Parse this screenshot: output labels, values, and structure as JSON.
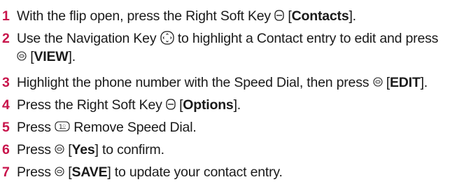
{
  "steps": [
    {
      "num": "1",
      "a": "With the flip open, press the Right Soft Key ",
      "b1": " [",
      "bold": "Contacts",
      "c": "]."
    },
    {
      "num": "2",
      "a": "Use the Navigation Key ",
      "b": " to highlight a Contact entry to edit and press",
      "line2_b": " [",
      "bold": "VIEW",
      "c": "]."
    },
    {
      "num": "3",
      "a": "Highlight the phone number with the Speed Dial, then press ",
      "b1": " [",
      "bold": "EDIT",
      "c": "]."
    },
    {
      "num": "4",
      "a": "Press the Right Soft Key ",
      "b1": " [",
      "bold": "Options",
      "c": "]."
    },
    {
      "num": "5",
      "a": "Press ",
      "b": " Remove Speed Dial."
    },
    {
      "num": "6",
      "a": "Press ",
      "b1": " [",
      "bold": "Yes",
      "c": "] to confirm."
    },
    {
      "num": "7",
      "a": "Press ",
      "b1": " [",
      "bold": "SAVE",
      "c": "] to update your contact entry."
    }
  ],
  "icons": {
    "soft_key": "right-soft-key-icon",
    "nav_key": "navigation-key-icon",
    "ok_key": "ok-key-icon",
    "one_key": "number-1-key-icon"
  },
  "colors": {
    "number": "#c8144b",
    "text": "#1a1a1a"
  }
}
